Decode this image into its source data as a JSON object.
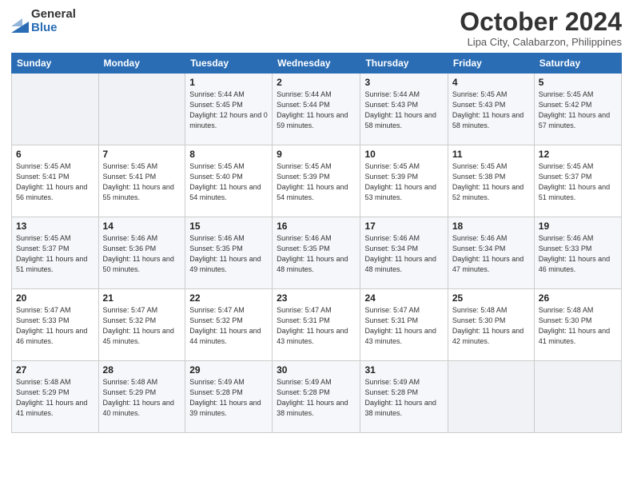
{
  "header": {
    "logo_general": "General",
    "logo_blue": "Blue",
    "month_title": "October 2024",
    "location": "Lipa City, Calabarzon, Philippines"
  },
  "days_of_week": [
    "Sunday",
    "Monday",
    "Tuesday",
    "Wednesday",
    "Thursday",
    "Friday",
    "Saturday"
  ],
  "weeks": [
    [
      {
        "day": "",
        "info": ""
      },
      {
        "day": "",
        "info": ""
      },
      {
        "day": "1",
        "info": "Sunrise: 5:44 AM\nSunset: 5:45 PM\nDaylight: 12 hours and 0 minutes."
      },
      {
        "day": "2",
        "info": "Sunrise: 5:44 AM\nSunset: 5:44 PM\nDaylight: 11 hours and 59 minutes."
      },
      {
        "day": "3",
        "info": "Sunrise: 5:44 AM\nSunset: 5:43 PM\nDaylight: 11 hours and 58 minutes."
      },
      {
        "day": "4",
        "info": "Sunrise: 5:45 AM\nSunset: 5:43 PM\nDaylight: 11 hours and 58 minutes."
      },
      {
        "day": "5",
        "info": "Sunrise: 5:45 AM\nSunset: 5:42 PM\nDaylight: 11 hours and 57 minutes."
      }
    ],
    [
      {
        "day": "6",
        "info": "Sunrise: 5:45 AM\nSunset: 5:41 PM\nDaylight: 11 hours and 56 minutes."
      },
      {
        "day": "7",
        "info": "Sunrise: 5:45 AM\nSunset: 5:41 PM\nDaylight: 11 hours and 55 minutes."
      },
      {
        "day": "8",
        "info": "Sunrise: 5:45 AM\nSunset: 5:40 PM\nDaylight: 11 hours and 54 minutes."
      },
      {
        "day": "9",
        "info": "Sunrise: 5:45 AM\nSunset: 5:39 PM\nDaylight: 11 hours and 54 minutes."
      },
      {
        "day": "10",
        "info": "Sunrise: 5:45 AM\nSunset: 5:39 PM\nDaylight: 11 hours and 53 minutes."
      },
      {
        "day": "11",
        "info": "Sunrise: 5:45 AM\nSunset: 5:38 PM\nDaylight: 11 hours and 52 minutes."
      },
      {
        "day": "12",
        "info": "Sunrise: 5:45 AM\nSunset: 5:37 PM\nDaylight: 11 hours and 51 minutes."
      }
    ],
    [
      {
        "day": "13",
        "info": "Sunrise: 5:45 AM\nSunset: 5:37 PM\nDaylight: 11 hours and 51 minutes."
      },
      {
        "day": "14",
        "info": "Sunrise: 5:46 AM\nSunset: 5:36 PM\nDaylight: 11 hours and 50 minutes."
      },
      {
        "day": "15",
        "info": "Sunrise: 5:46 AM\nSunset: 5:35 PM\nDaylight: 11 hours and 49 minutes."
      },
      {
        "day": "16",
        "info": "Sunrise: 5:46 AM\nSunset: 5:35 PM\nDaylight: 11 hours and 48 minutes."
      },
      {
        "day": "17",
        "info": "Sunrise: 5:46 AM\nSunset: 5:34 PM\nDaylight: 11 hours and 48 minutes."
      },
      {
        "day": "18",
        "info": "Sunrise: 5:46 AM\nSunset: 5:34 PM\nDaylight: 11 hours and 47 minutes."
      },
      {
        "day": "19",
        "info": "Sunrise: 5:46 AM\nSunset: 5:33 PM\nDaylight: 11 hours and 46 minutes."
      }
    ],
    [
      {
        "day": "20",
        "info": "Sunrise: 5:47 AM\nSunset: 5:33 PM\nDaylight: 11 hours and 46 minutes."
      },
      {
        "day": "21",
        "info": "Sunrise: 5:47 AM\nSunset: 5:32 PM\nDaylight: 11 hours and 45 minutes."
      },
      {
        "day": "22",
        "info": "Sunrise: 5:47 AM\nSunset: 5:32 PM\nDaylight: 11 hours and 44 minutes."
      },
      {
        "day": "23",
        "info": "Sunrise: 5:47 AM\nSunset: 5:31 PM\nDaylight: 11 hours and 43 minutes."
      },
      {
        "day": "24",
        "info": "Sunrise: 5:47 AM\nSunset: 5:31 PM\nDaylight: 11 hours and 43 minutes."
      },
      {
        "day": "25",
        "info": "Sunrise: 5:48 AM\nSunset: 5:30 PM\nDaylight: 11 hours and 42 minutes."
      },
      {
        "day": "26",
        "info": "Sunrise: 5:48 AM\nSunset: 5:30 PM\nDaylight: 11 hours and 41 minutes."
      }
    ],
    [
      {
        "day": "27",
        "info": "Sunrise: 5:48 AM\nSunset: 5:29 PM\nDaylight: 11 hours and 41 minutes."
      },
      {
        "day": "28",
        "info": "Sunrise: 5:48 AM\nSunset: 5:29 PM\nDaylight: 11 hours and 40 minutes."
      },
      {
        "day": "29",
        "info": "Sunrise: 5:49 AM\nSunset: 5:28 PM\nDaylight: 11 hours and 39 minutes."
      },
      {
        "day": "30",
        "info": "Sunrise: 5:49 AM\nSunset: 5:28 PM\nDaylight: 11 hours and 38 minutes."
      },
      {
        "day": "31",
        "info": "Sunrise: 5:49 AM\nSunset: 5:28 PM\nDaylight: 11 hours and 38 minutes."
      },
      {
        "day": "",
        "info": ""
      },
      {
        "day": "",
        "info": ""
      }
    ]
  ]
}
